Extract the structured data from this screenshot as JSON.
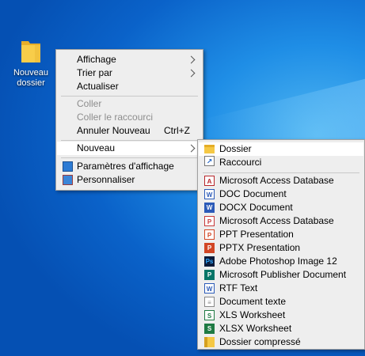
{
  "desktop": {
    "icon": {
      "name": "folder-icon",
      "label": "Nouveau dossier"
    }
  },
  "context_menu": {
    "items": [
      {
        "label": "Affichage",
        "submenu": true
      },
      {
        "label": "Trier par",
        "submenu": true
      },
      {
        "label": "Actualiser"
      },
      {
        "label": "Coller",
        "disabled": true
      },
      {
        "label": "Coller le raccourci",
        "disabled": true
      },
      {
        "label": "Annuler Nouveau",
        "shortcut": "Ctrl+Z"
      },
      {
        "label": "Nouveau",
        "submenu": true,
        "highlighted": true
      },
      {
        "label": "Paramètres d'affichage",
        "icon": "display-settings-icon"
      },
      {
        "label": "Personnaliser",
        "icon": "personalize-icon"
      }
    ]
  },
  "new_submenu": {
    "items": [
      {
        "label": "Dossier",
        "icon": "folder-icon",
        "highlighted": true
      },
      {
        "label": "Raccourci",
        "icon": "shortcut-icon"
      },
      {
        "label": "Microsoft Access Database",
        "icon": "access-icon"
      },
      {
        "label": "DOC Document",
        "icon": "word-doc-icon"
      },
      {
        "label": "DOCX Document",
        "icon": "word-docx-icon"
      },
      {
        "label": "Microsoft Access Database",
        "icon": "access-pdf-icon"
      },
      {
        "label": "PPT Presentation",
        "icon": "ppt-icon"
      },
      {
        "label": "PPTX Presentation",
        "icon": "pptx-icon"
      },
      {
        "label": "Adobe Photoshop Image 12",
        "icon": "photoshop-icon"
      },
      {
        "label": "Microsoft Publisher Document",
        "icon": "publisher-icon"
      },
      {
        "label": "RTF Text",
        "icon": "rtf-icon"
      },
      {
        "label": "Document texte",
        "icon": "text-document-icon"
      },
      {
        "label": "XLS Worksheet",
        "icon": "xls-icon"
      },
      {
        "label": "XLSX Worksheet",
        "icon": "xlsx-icon"
      },
      {
        "label": "Dossier compressé",
        "icon": "zip-folder-icon"
      }
    ]
  },
  "colors": {
    "desktop_background": "#0a62c9",
    "menu_background": "#eeeeee",
    "highlight": "#ffffff",
    "disabled_text": "#8d8d8d"
  }
}
